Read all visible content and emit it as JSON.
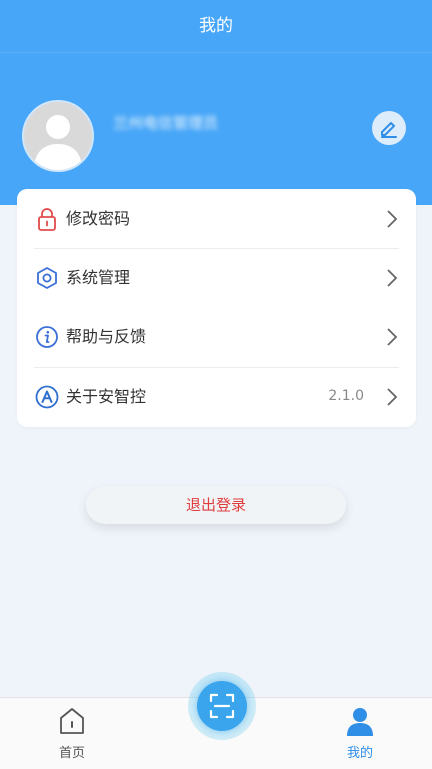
{
  "header": {
    "title": "我的",
    "username": "兰州电信管理员"
  },
  "menu": {
    "items": [
      {
        "label": "修改密码",
        "icon": "lock-icon"
      },
      {
        "label": "系统管理",
        "icon": "hexagon-settings-icon"
      },
      {
        "label": "帮助与反馈",
        "icon": "info-icon"
      },
      {
        "label": "关于安智控",
        "icon": "letter-a-icon",
        "version": "2.1.0"
      }
    ]
  },
  "logout_label": "退出登录",
  "tabbar": {
    "tabs": [
      {
        "label": "首页",
        "icon": "home-icon",
        "active": false
      },
      {
        "label": "我的",
        "icon": "person-icon",
        "active": true
      }
    ],
    "scan_icon": "scan-icon"
  },
  "colors": {
    "primary": "#47a6f7",
    "lock": "#e24b4b",
    "logout": "#e03c3c",
    "active_tab": "#2f8fe6",
    "inactive_tab": "#555555"
  }
}
